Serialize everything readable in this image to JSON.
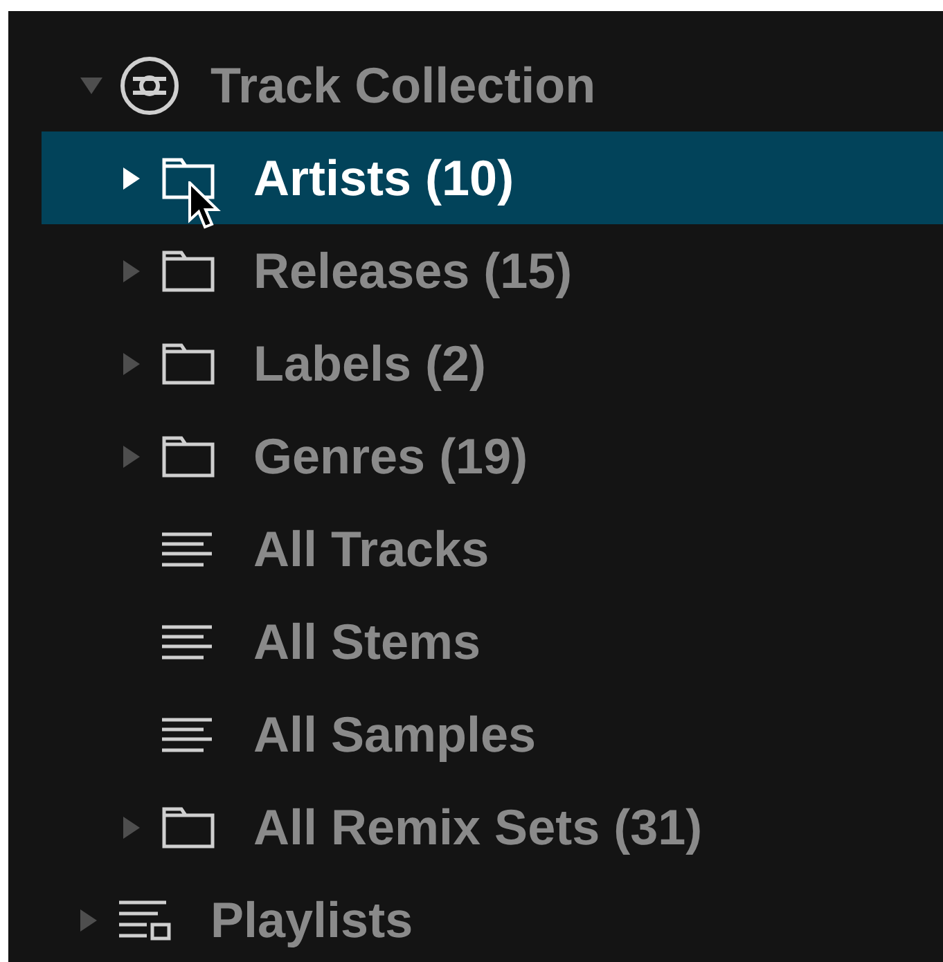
{
  "tree": [
    {
      "label": "Track Collection",
      "kind": "collection",
      "expanded": true,
      "selected": false,
      "children": [
        {
          "label": "Artists (10)",
          "kind": "folder",
          "expanded": false,
          "selected": true,
          "cursor": true
        },
        {
          "label": "Releases (15)",
          "kind": "folder",
          "expanded": false,
          "selected": false
        },
        {
          "label": "Labels (2)",
          "kind": "folder",
          "expanded": false,
          "selected": false
        },
        {
          "label": "Genres (19)",
          "kind": "folder",
          "expanded": false,
          "selected": false
        },
        {
          "label": "All Tracks",
          "kind": "list",
          "selected": false
        },
        {
          "label": "All Stems",
          "kind": "list",
          "selected": false
        },
        {
          "label": "All Samples",
          "kind": "list",
          "selected": false
        },
        {
          "label": "All Remix Sets (31)",
          "kind": "folder",
          "expanded": false,
          "selected": false
        }
      ]
    },
    {
      "label": "Playlists",
      "kind": "playlists",
      "expanded": false,
      "selected": false
    }
  ]
}
